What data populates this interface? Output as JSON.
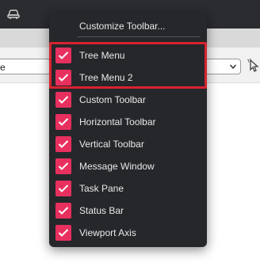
{
  "menu": {
    "header": "Customize Toolbar...",
    "items": [
      {
        "label": "Tree Menu",
        "checked": true
      },
      {
        "label": "Tree Menu 2",
        "checked": true
      },
      {
        "label": "Custom Toolbar",
        "checked": true
      },
      {
        "label": "Horizontal Toolbar",
        "checked": true
      },
      {
        "label": "Vertical Toolbar",
        "checked": true
      },
      {
        "label": "Message Window",
        "checked": true
      },
      {
        "label": "Task Pane",
        "checked": true
      },
      {
        "label": "Status Bar",
        "checked": true
      },
      {
        "label": "Viewport Axis",
        "checked": true
      }
    ]
  },
  "background": {
    "select_left_text": "se"
  },
  "colors": {
    "menu_bg": "#26272b",
    "check_accent": "#e8305e",
    "highlight_border": "#d6232f"
  },
  "icons": {
    "app": "car-icon",
    "dropdown": "chevron-down-icon",
    "picker": "cursor-pick-icon",
    "check": "checkmark-icon"
  }
}
